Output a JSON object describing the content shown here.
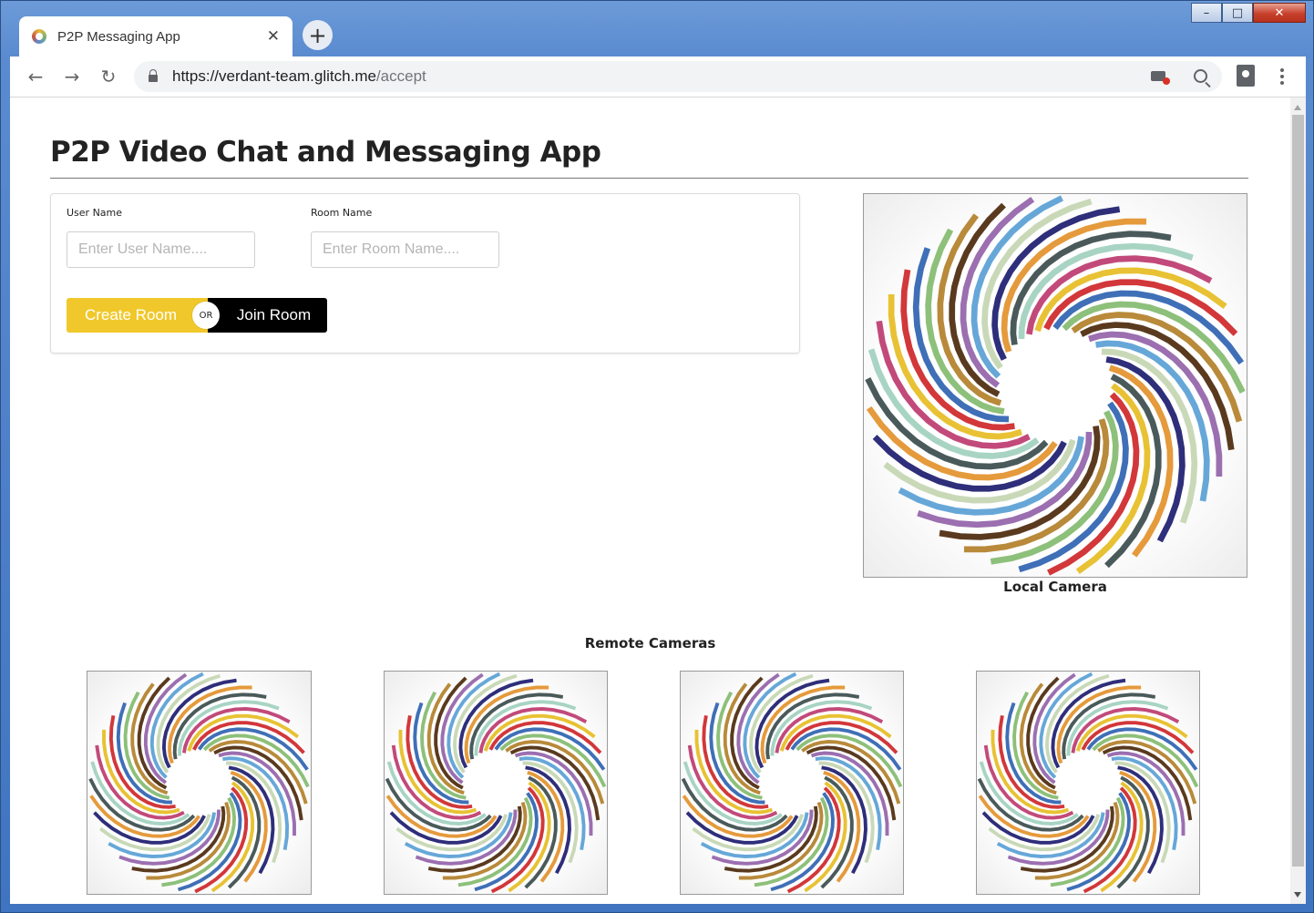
{
  "browser": {
    "tab_title": "P2P Messaging App",
    "tab_close": "✕",
    "new_tab": "+",
    "url_host": "https://verdant-team.glitch.me",
    "url_path": "/accept",
    "back_icon": "←",
    "forward_icon": "→",
    "reload_icon": "↻"
  },
  "window_controls": {
    "minimize": "–",
    "maximize": "□",
    "close": "✕"
  },
  "page": {
    "title": "P2P Video Chat and Messaging App"
  },
  "form": {
    "user_label": "User Name",
    "user_placeholder": "Enter User Name....",
    "room_label": "Room Name",
    "room_placeholder": "Enter Room Name....",
    "create_button": "Create Room",
    "or_label": "OR",
    "join_button": "Join Room"
  },
  "video": {
    "local_caption": "Local Camera",
    "remote_heading": "Remote Cameras"
  },
  "colors": {
    "create_button": "#f1c82b",
    "join_button": "#000000",
    "swirl_palette": [
      "#e8c234",
      "#d2373a",
      "#3f6fb7",
      "#8dc07a",
      "#b88a3a",
      "#5a3a1e",
      "#9b6fb0",
      "#66a7d8",
      "#c9d9b8",
      "#2e2e7a",
      "#e59a3c",
      "#4a5a5a",
      "#a8d4c4",
      "#c24a7a"
    ]
  }
}
